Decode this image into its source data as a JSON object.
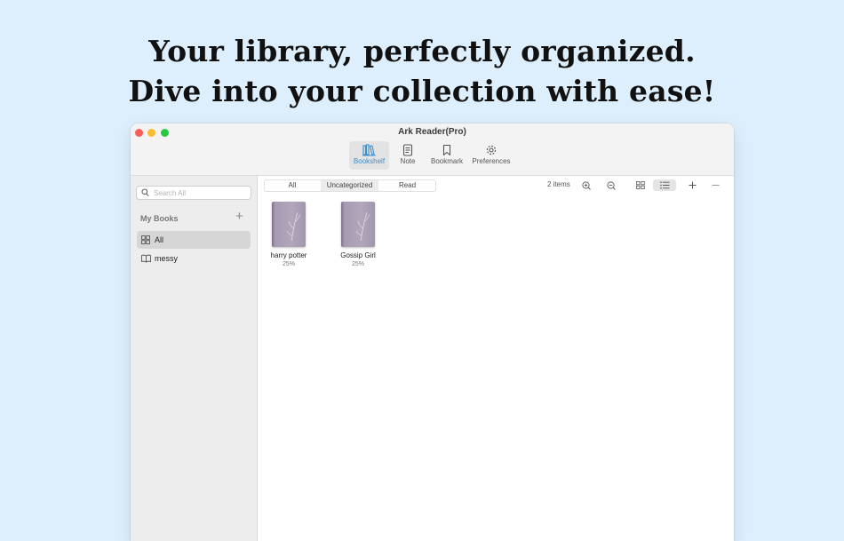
{
  "headline": {
    "line1": "Your library, perfectly organized.",
    "line2": "Dive into your collection with ease!"
  },
  "window": {
    "title": "Ark Reader(Pro)",
    "toolbar": [
      {
        "label": "Bookshelf",
        "icon": "bookshelf-icon",
        "active": true
      },
      {
        "label": "Note",
        "icon": "note-icon",
        "active": false
      },
      {
        "label": "Bookmark",
        "icon": "bookmark-icon",
        "active": false
      },
      {
        "label": "Preferences",
        "icon": "gear-icon",
        "active": false
      }
    ]
  },
  "sidebar": {
    "search_placeholder": "Search All",
    "section_title": "My Books",
    "items": [
      {
        "label": "All",
        "icon": "grid-icon",
        "selected": true
      },
      {
        "label": "messy",
        "icon": "book-icon",
        "selected": false
      }
    ]
  },
  "filters": [
    {
      "label": "All",
      "selected": false
    },
    {
      "label": "Uncategorized",
      "selected": true
    },
    {
      "label": "Read",
      "selected": false
    }
  ],
  "item_count": "2 items",
  "books": [
    {
      "title": "harry potter",
      "progress": "25%"
    },
    {
      "title": "Gossip Girl",
      "progress": "25%"
    }
  ],
  "colors": {
    "background": "#ddeefc",
    "accent": "#3d8ec9",
    "cover": "#a79bb2"
  }
}
